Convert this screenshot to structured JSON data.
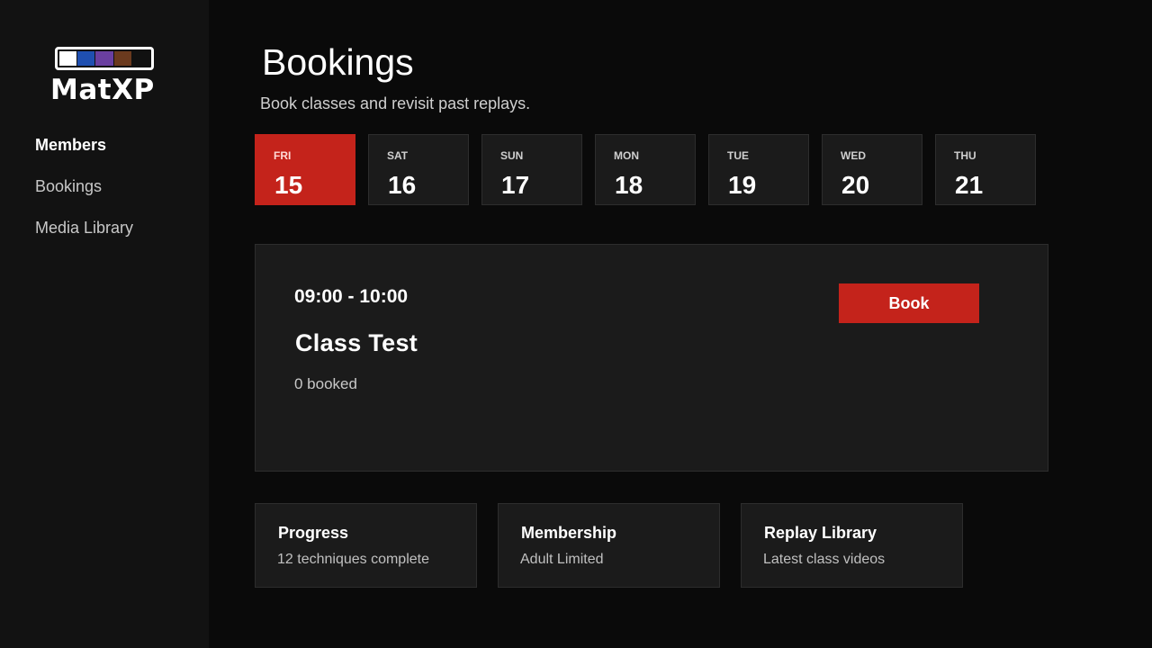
{
  "app": {
    "logo_text": "MatXP",
    "belt_colors": [
      "#ffffff",
      "#1f4fb0",
      "#6a3fa0",
      "#6b3a1e",
      "#111111"
    ]
  },
  "sidebar": {
    "items": [
      {
        "label": "Members",
        "active": true
      },
      {
        "label": "Bookings",
        "active": false
      },
      {
        "label": "Media Library",
        "active": false
      }
    ]
  },
  "header": {
    "title": "Bookings",
    "subtitle": "Book classes and revisit past replays."
  },
  "days": [
    {
      "name": "FRI",
      "num": "15",
      "selected": true
    },
    {
      "name": "SAT",
      "num": "16",
      "selected": false
    },
    {
      "name": "SUN",
      "num": "17",
      "selected": false
    },
    {
      "name": "MON",
      "num": "18",
      "selected": false
    },
    {
      "name": "TUE",
      "num": "19",
      "selected": false
    },
    {
      "name": "WED",
      "num": "20",
      "selected": false
    },
    {
      "name": "THU",
      "num": "21",
      "selected": false
    }
  ],
  "class_card": {
    "time": "09:00 - 10:00",
    "name": "Class Test",
    "booked": "0 booked",
    "button_label": "Book"
  },
  "tiles": [
    {
      "title": "Progress",
      "subtitle": "12 techniques complete"
    },
    {
      "title": "Membership",
      "subtitle": "Adult Limited"
    },
    {
      "title": "Replay Library",
      "subtitle": "Latest class videos"
    }
  ],
  "colors": {
    "accent": "#c4231b",
    "background": "#0a0a0a",
    "sidebar": "#121212",
    "card": "#1b1b1b"
  }
}
